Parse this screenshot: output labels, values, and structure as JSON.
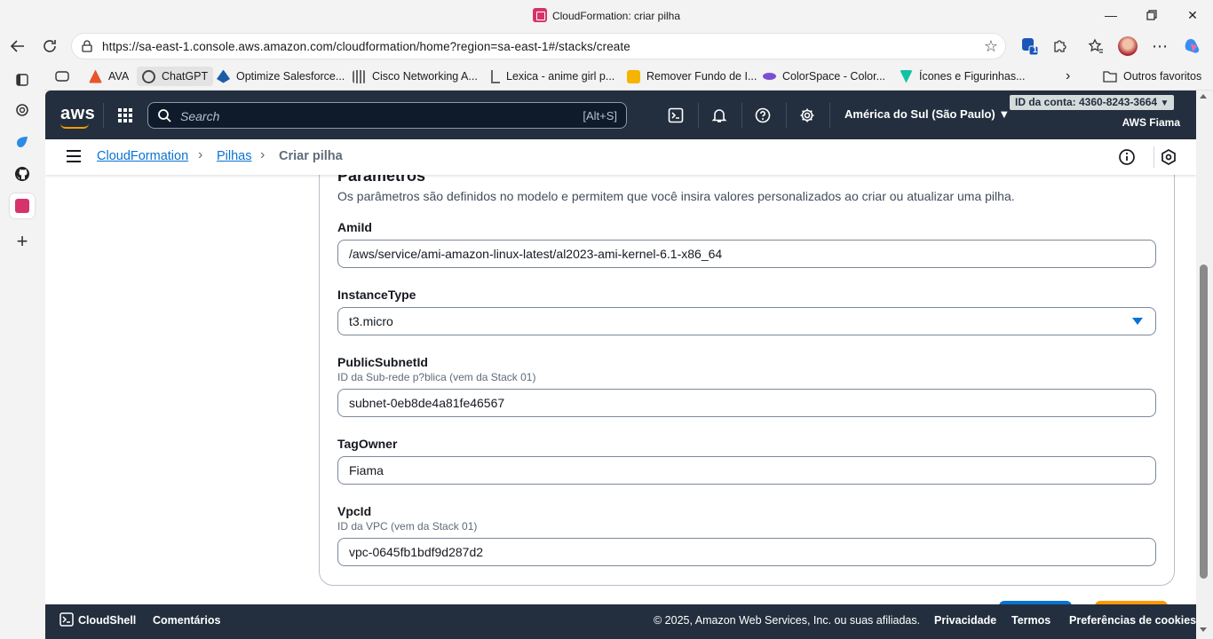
{
  "browser": {
    "window_title": "CloudFormation: criar pilha",
    "url": "https://sa-east-1.console.aws.amazon.com/cloudformation/home?region=sa-east-1#/stacks/create",
    "extension_badge": "1",
    "bookmarks": [
      {
        "label": "AVA",
        "color": "#e8552b"
      },
      {
        "label": "ChatGPT",
        "color": "#444444"
      },
      {
        "label": "Optimize Salesforce...",
        "color": "#1b5ea7"
      },
      {
        "label": "Cisco Networking A...",
        "color": "#666666"
      },
      {
        "label": "Lexica - anime girl p...",
        "color": "#888888"
      },
      {
        "label": "Remover Fundo de I...",
        "color": "#f5b400"
      },
      {
        "label": "ColorSpace - Color...",
        "color": "#7b4fd0"
      },
      {
        "label": "Ícones e Figurinhas...",
        "color": "#12c2a5"
      }
    ],
    "other_favorites": "Outros favoritos"
  },
  "aws": {
    "search_placeholder": "Search",
    "search_shortcut": "[Alt+S]",
    "region": "América do Sul (São Paulo)",
    "account_id": "ID da conta: 4360-8243-3664",
    "account_name": "AWS Fiama",
    "breadcrumb": {
      "service": "CloudFormation",
      "section": "Pilhas",
      "current": "Criar pilha"
    }
  },
  "parameters": {
    "title": "Parâmetros",
    "description": "Os parâmetros são definidos no modelo e permitem que você insira valores personalizados ao criar ou atualizar uma pilha.",
    "fields": [
      {
        "label": "AmiId",
        "hint": "",
        "value": "/aws/service/ami-amazon-linux-latest/al2023-ami-kernel-6.1-x86_64"
      },
      {
        "label": "InstanceType",
        "hint": "",
        "value": "t3.micro"
      },
      {
        "label": "PublicSubnetId",
        "hint": "ID da Sub-rede p?blica (vem da Stack 01)",
        "value": "subnet-0eb8de4a81fe46567"
      },
      {
        "label": "TagOwner",
        "hint": "",
        "value": "Fiama"
      },
      {
        "label": "VpcId",
        "hint": "ID da VPC (vem da Stack 01)",
        "value": "vpc-0645fb1bdf9d287d2"
      }
    ]
  },
  "footer": {
    "cloudshell": "CloudShell",
    "feedback": "Comentários",
    "copyright": "© 2025, Amazon Web Services, Inc. ou suas afiliadas.",
    "privacy": "Privacidade",
    "terms": "Termos",
    "cookies": "Preferências de cookies"
  }
}
